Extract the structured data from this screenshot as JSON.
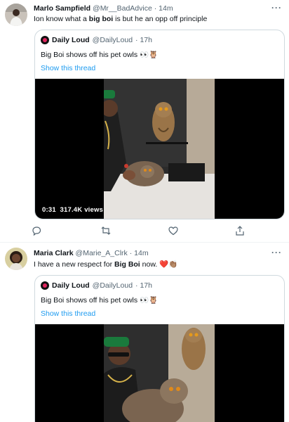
{
  "tweet1": {
    "name": "Marlo Sampfield",
    "handle": "@Mr__BadAdvice",
    "time": "· 14m",
    "text_before": "Ion know what a ",
    "text_bold": "big boi",
    "text_after": " is but he an opp off principle",
    "quote": {
      "name": "Daily Loud",
      "handle": "@DailyLoud",
      "time": "· 17h",
      "text": "Big Boi shows off his pet owls 👀🦉",
      "show_thread": "Show this thread",
      "video_time": "0:31",
      "video_views": "317.4K views"
    }
  },
  "tweet2": {
    "name": "Maria Clark",
    "handle": "@Marie_A_Clrk",
    "time": "· 14m",
    "text_before": "I have a new respect for ",
    "text_bold": "Big Boi",
    "text_after": " now. ❤️👏🏽",
    "quote": {
      "name": "Daily Loud",
      "handle": "@DailyLoud",
      "time": "· 17h",
      "text": "Big Boi shows off his pet owls 👀🦉",
      "show_thread": "Show this thread"
    }
  },
  "more_label": "···",
  "icons": [
    "reply-icon",
    "retweet-icon",
    "like-icon",
    "share-icon",
    "more-icon"
  ]
}
